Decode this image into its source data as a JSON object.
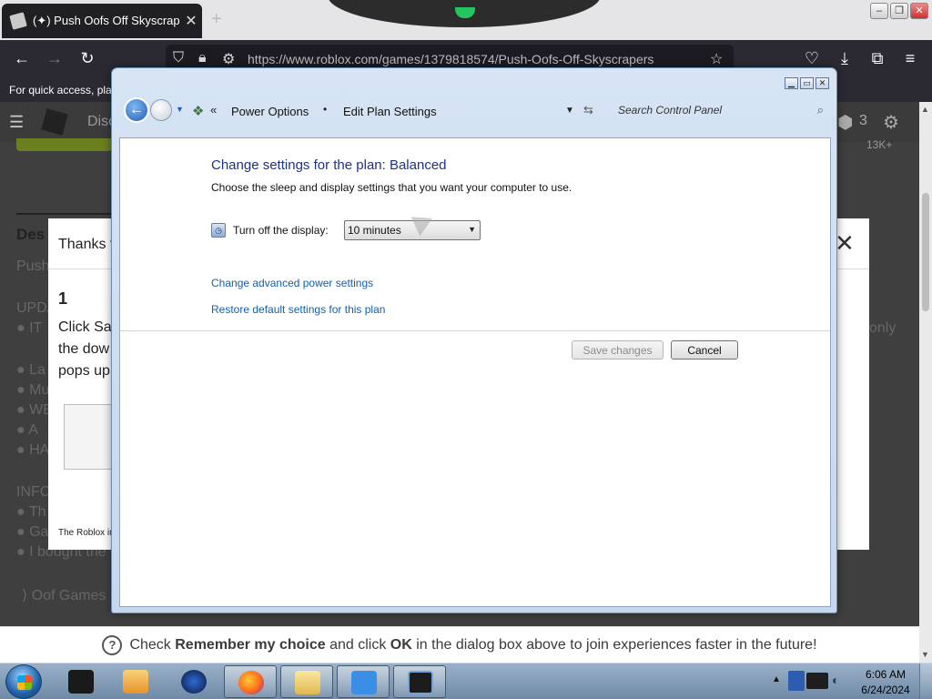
{
  "browser": {
    "tab_title": "(✦) Push Oofs Off Skyscraper",
    "tab_close": "✕",
    "new_tab": "+",
    "url": "https://www.roblox.com/games/1379818574/Push-Oofs-Off-Skyscrapers",
    "bookmarks_text": "For quick access, plac"
  },
  "page": {
    "nav_partial": "Disc",
    "robux_count": "3",
    "followers": "13K+",
    "desc_partial": "Des",
    "bg_lines": [
      "Push",
      "UPD/",
      "● IT",
      "● La",
      "● Mu",
      "● WE",
      "● A",
      "● HA",
      "INFC",
      "● Th",
      "● Ga",
      "● I bought the"
    ],
    "bg_right": "only",
    "footer_link": "⟩ Oof Games",
    "thanks_title": "Thanks f",
    "step_number": "1",
    "step_text_1": "Click Sa",
    "step_text_2": "the dow",
    "step_text_3": "pops up",
    "footnote": "The Roblox in",
    "banner_prefix": "Check ",
    "banner_bold1": "Remember my choice",
    "banner_mid": " and click ",
    "banner_bold2": "OK",
    "banner_suffix": " in the dialog box above to join experiences faster in the future!"
  },
  "control_panel": {
    "breadcrumb_1": "Power Options",
    "breadcrumb_sep": "•",
    "breadcrumb_2": "Edit Plan Settings",
    "breadcrumb_more": "«",
    "search_placeholder": "Search Control Panel",
    "heading": "Change settings for the plan: Balanced",
    "subtext": "Choose the sleep and display settings that you want your computer to use.",
    "display_label": "Turn off the display:",
    "display_value": "10 minutes",
    "link_advanced": "Change advanced power settings",
    "link_restore": "Restore default settings for this plan",
    "save_label": "Save changes",
    "cancel_label": "Cancel"
  },
  "taskbar": {
    "time": "6:06 AM",
    "date": "6/24/2024"
  },
  "colors": {
    "link": "#1560a8",
    "heading": "#1e3287",
    "taskbar": "#7f99b4"
  }
}
